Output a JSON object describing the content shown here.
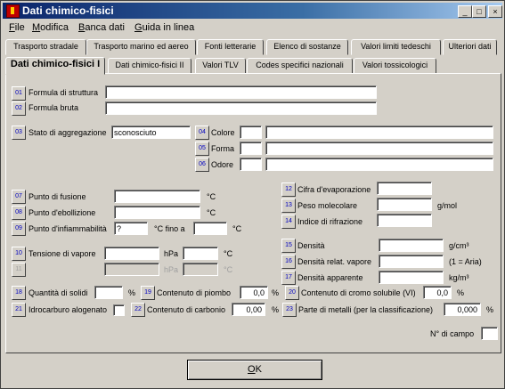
{
  "window": {
    "title": "Dati chimico-fisici",
    "controls": [
      "_",
      "□",
      "×"
    ]
  },
  "menu": [
    {
      "label": "File",
      "key": "F",
      "rest": "ile"
    },
    {
      "label": "Modifica",
      "key": "M",
      "rest": "odifica"
    },
    {
      "label": "Banca dati",
      "key": "B",
      "rest": "anca dati"
    },
    {
      "label": "Guida in linea",
      "key": "G",
      "rest": "uida in linea"
    }
  ],
  "tabs_row1": [
    "Trasporto stradale",
    "Trasporto marino ed aereo",
    "Fonti letterarie",
    "Elenco di sostanze",
    "Valori limiti tedeschi",
    "Ulteriori dati"
  ],
  "tabs_row2": [
    "Dati chimico-fisici I",
    "Dati chimico-fisici II",
    "Valori TLV",
    "Codes specifici nazionali",
    "Valori tossicologici"
  ],
  "fields": {
    "n01": "01",
    "formula_struttura": "Formula di struttura",
    "n02": "02",
    "formula_bruta": "Formula bruta",
    "n03": "03",
    "stato_aggregazione": "Stato di aggregazione",
    "stato_value": "sconosciuto",
    "n04": "04",
    "colore": "Colore",
    "n05": "05",
    "forma": "Forma",
    "n06": "06",
    "odore": "Odore",
    "n07": "07",
    "punto_fusione": "Punto di fusione",
    "unit_c": "°C",
    "n08": "08",
    "punto_ebollizione": "Punto d'ebollizione",
    "n09": "09",
    "punto_infiammabilita": "Punto d'infiammabilità",
    "infiammabilita_value": "?",
    "fino_a": "°C  fino a",
    "n10": "10",
    "tensione_vapore": "Tensione di vapore",
    "unit_hpa": "hPa",
    "n11": "11",
    "n12": "12",
    "cifra_evaporazione": "Cifra d'evaporazione",
    "n13": "13",
    "peso_molecolare": "Peso molecolare",
    "unit_gmol": "g/mol",
    "n14": "14",
    "indice_rifrazione": "Indice di rifrazione",
    "n15": "15",
    "densita": "Densità",
    "unit_gcm3": "g/cm³",
    "n16": "16",
    "densita_vapore": "Densità relat. vapore",
    "unit_aria": "(1 = Aria)",
    "n17": "17",
    "densita_apparente": "Densità apparente",
    "unit_kgm3": "kg/m³",
    "n18": "18",
    "quantita_solidi": "Quantità di solidi",
    "unit_pct": "%",
    "n19": "19",
    "contenuto_piombo": "Contenuto di piombo",
    "piombo_value": "0,0",
    "n20": "20",
    "contenuto_cromo": "Contenuto di cromo solubile (VI)",
    "cromo_value": "0,0",
    "n21": "21",
    "idrocarburo": "Idrocarburo alogenato",
    "n22": "22",
    "contenuto_carbonio": "Contenuto di carbonio",
    "carbonio_value": "0,00",
    "n23": "23",
    "parte_metalli": "Parte di metalli (per la classificazione)",
    "metalli_value": "0,000",
    "numero_campo": "N° di campo"
  },
  "ok": {
    "key": "O",
    "rest": "K"
  }
}
